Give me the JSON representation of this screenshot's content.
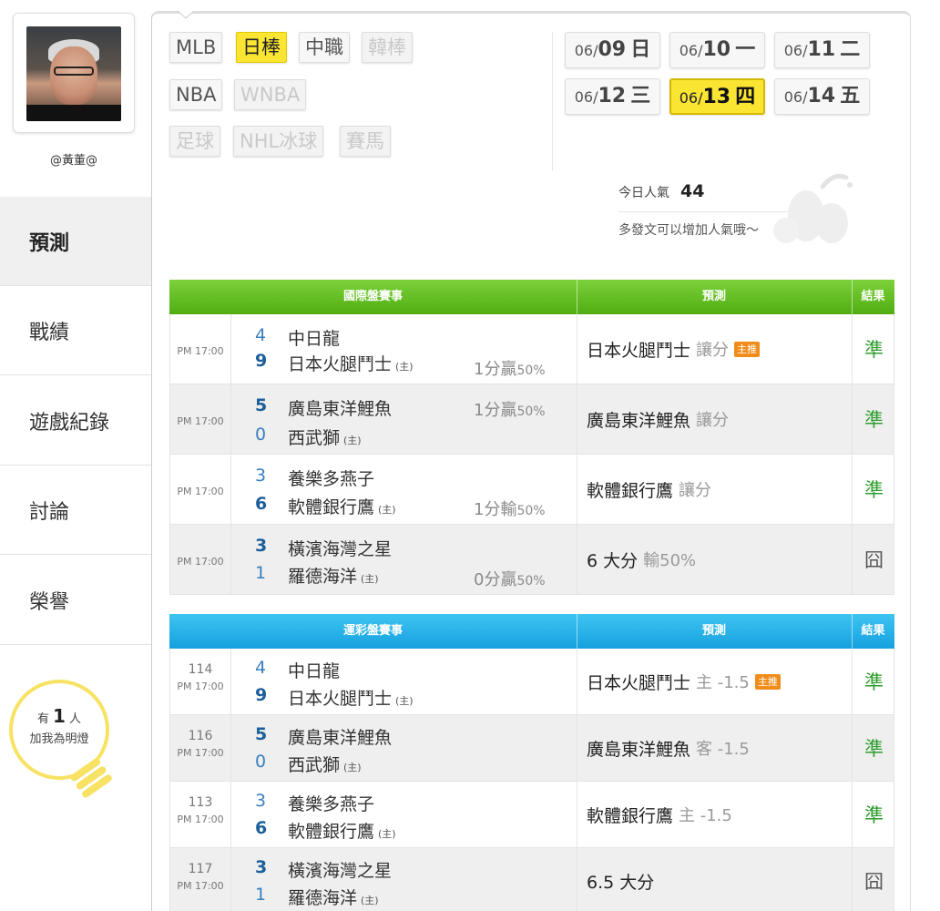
{
  "user": {
    "name": "@黃董@"
  },
  "nav": {
    "items": [
      {
        "label": "預測",
        "active": true
      },
      {
        "label": "戰績",
        "active": false
      },
      {
        "label": "遊戲紀錄",
        "active": false
      },
      {
        "label": "討論",
        "active": false
      },
      {
        "label": "榮譽",
        "active": false
      }
    ]
  },
  "bulb": {
    "prefix": "有",
    "count": "1",
    "suffix": "人",
    "line2": "加我為明燈"
  },
  "sports": {
    "tabs": [
      {
        "label": "MLB",
        "state": "normal"
      },
      {
        "label": "日棒",
        "state": "selected"
      },
      {
        "label": "中職",
        "state": "normal"
      },
      {
        "label": "韓棒",
        "state": "disabled"
      },
      {
        "label": "NBA",
        "state": "normal"
      },
      {
        "label": "WNBA",
        "state": "disabled"
      },
      {
        "label": "足球",
        "state": "disabled"
      },
      {
        "label": "NHL冰球",
        "state": "disabled"
      },
      {
        "label": "賽馬",
        "state": "disabled"
      }
    ]
  },
  "dates": [
    {
      "month": "06/",
      "day": "09",
      "weekday": "日",
      "selected": false
    },
    {
      "month": "06/",
      "day": "10",
      "weekday": "一",
      "selected": false
    },
    {
      "month": "06/",
      "day": "11",
      "weekday": "二",
      "selected": false
    },
    {
      "month": "06/",
      "day": "12",
      "weekday": "三",
      "selected": false
    },
    {
      "month": "06/",
      "day": "13",
      "weekday": "四",
      "selected": true
    },
    {
      "month": "06/",
      "day": "14",
      "weekday": "五",
      "selected": false
    }
  ],
  "popularity": {
    "label": "今日人氣",
    "value": "44",
    "hint": "多發文可以增加人氣哦～"
  },
  "intl_table": {
    "header": {
      "match": "國際盤賽事",
      "prediction": "預測",
      "result": "結果"
    },
    "rows": [
      {
        "time": "PM 17:00",
        "away_score": "4",
        "away": "中日龍",
        "home_score": "9",
        "home": "日本火腿鬥士",
        "home_mark": "(主)",
        "handicap_num": "1分贏",
        "handicap_pct": "50%",
        "handicap_row": "home",
        "winner": "home",
        "pick": "日本火腿鬥士",
        "pick_type": "讓分",
        "badge": "主推",
        "result": "準"
      },
      {
        "time": "PM 17:00",
        "away_score": "5",
        "away": "廣島東洋鯉魚",
        "home_score": "0",
        "home": "西武獅",
        "home_mark": "(主)",
        "handicap_num": "1分贏",
        "handicap_pct": "50%",
        "handicap_row": "away",
        "winner": "away",
        "pick": "廣島東洋鯉魚",
        "pick_type": "讓分",
        "badge": "",
        "result": "準"
      },
      {
        "time": "PM 17:00",
        "away_score": "3",
        "away": "養樂多燕子",
        "home_score": "6",
        "home": "軟體銀行鷹",
        "home_mark": "(主)",
        "handicap_num": "1分輸",
        "handicap_pct": "50%",
        "handicap_row": "home",
        "winner": "home",
        "pick": "軟體銀行鷹",
        "pick_type": "讓分",
        "badge": "",
        "result": "準"
      },
      {
        "time": "PM 17:00",
        "away_score": "3",
        "away": "橫濱海灣之星",
        "home_score": "1",
        "home": "羅德海洋",
        "home_mark": "(主)",
        "handicap_num": "0分贏",
        "handicap_pct": "50%",
        "handicap_row": "home",
        "winner": "away",
        "pick": "6 大分",
        "pick_type": "輸50%",
        "badge": "",
        "result": "囧"
      }
    ]
  },
  "sport_table": {
    "header": {
      "match": "運彩盤賽事",
      "prediction": "預測",
      "result": "結果"
    },
    "rows": [
      {
        "id": "114",
        "time": "PM 17:00",
        "away_score": "4",
        "away": "中日龍",
        "home_score": "9",
        "home": "日本火腿鬥士",
        "home_mark": "(主)",
        "winner": "home",
        "pick": "日本火腿鬥士",
        "pick_type": "主 -1.5",
        "badge": "主推",
        "result": "準"
      },
      {
        "id": "116",
        "time": "PM 17:00",
        "away_score": "5",
        "away": "廣島東洋鯉魚",
        "home_score": "0",
        "home": "西武獅",
        "home_mark": "(主)",
        "winner": "away",
        "pick": "廣島東洋鯉魚",
        "pick_type": "客 -1.5",
        "badge": "",
        "result": "準"
      },
      {
        "id": "113",
        "time": "PM 17:00",
        "away_score": "3",
        "away": "養樂多燕子",
        "home_score": "6",
        "home": "軟體銀行鷹",
        "home_mark": "(主)",
        "winner": "home",
        "pick": "軟體銀行鷹",
        "pick_type": "主 -1.5",
        "badge": "",
        "result": "準"
      },
      {
        "id": "117",
        "time": "PM 17:00",
        "away_score": "3",
        "away": "橫濱海灣之星",
        "home_score": "1",
        "home": "羅德海洋",
        "home_mark": "(主)",
        "winner": "away",
        "pick": "6.5 大分",
        "pick_type": "",
        "badge": "",
        "result": "囧"
      }
    ]
  },
  "colors": {
    "accent_yellow": "#f9e532",
    "green_header": "#5cb81e",
    "blue_header": "#22aee6",
    "good": "#2e9d2e"
  }
}
